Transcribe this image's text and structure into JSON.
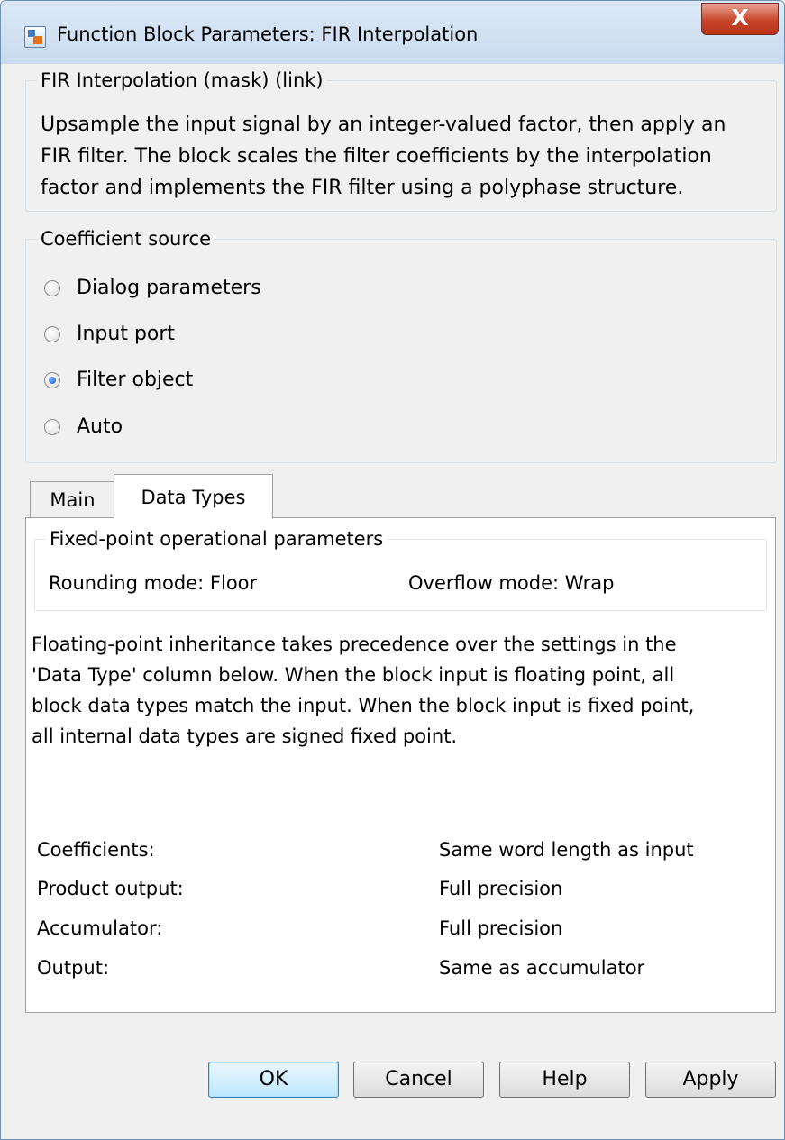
{
  "window": {
    "title": "Function Block Parameters: FIR Interpolation",
    "close_symbol": "X"
  },
  "mask": {
    "header": "FIR Interpolation (mask) (link)",
    "description_lines": [
      "Upsample the input signal by an integer-valued factor, then apply an",
      "FIR filter. The block scales the filter coefficients by the interpolation",
      "factor and implements the FIR filter using a polyphase structure."
    ]
  },
  "coefficient_source": {
    "label": "Coefficient source",
    "options": [
      "Dialog parameters",
      "Input port",
      "Filter object",
      "Auto"
    ],
    "selected": "Filter object"
  },
  "tabs": [
    {
      "label": "Main",
      "active": false
    },
    {
      "label": "Data Types",
      "active": true
    }
  ],
  "fixed_point": {
    "label": "Fixed-point operational parameters",
    "rounding_mode": "Rounding mode:  Floor",
    "overflow_mode": "Overflow mode:  Wrap"
  },
  "inheritance_note_lines": [
    "Floating-point inheritance takes precedence over the settings in the",
    "'Data Type' column below. When the block input is floating point, all",
    "block data types match the input. When the block input is fixed point,",
    "all internal data types are signed fixed point."
  ],
  "data_types": [
    {
      "label": "Coefficients:",
      "value": "Same word length as input"
    },
    {
      "label": "Product output:",
      "value": "Full precision"
    },
    {
      "label": "Accumulator:",
      "value": "Full precision"
    },
    {
      "label": "Output:",
      "value": "Same as accumulator"
    }
  ],
  "buttons": {
    "ok": "OK",
    "cancel": "Cancel",
    "help": "Help",
    "apply": "Apply"
  }
}
